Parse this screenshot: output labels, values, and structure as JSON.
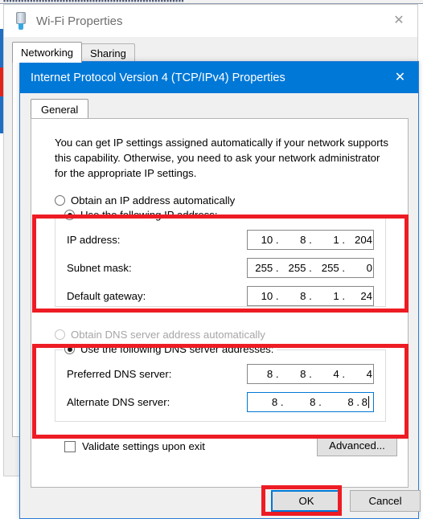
{
  "background_window": {
    "title": "Wi-Fi Properties",
    "icon": "network-adapter-icon",
    "close_label": "✕",
    "tabs": [
      {
        "label": "Networking",
        "active": true
      },
      {
        "label": "Sharing",
        "active": false
      }
    ]
  },
  "dialog": {
    "title": "Internet Protocol Version 4 (TCP/IPv4) Properties",
    "close_label": "✕",
    "tab": {
      "label": "General",
      "active": true
    },
    "intro_text": "You can get IP settings assigned automatically if your network supports this capability. Otherwise, you need to ask your network administrator for the appropriate IP settings.",
    "ip_section": {
      "auto_option": {
        "label": "Obtain an IP address automatically",
        "checked": false,
        "disabled": false
      },
      "manual_option": {
        "label": "Use the following IP address:",
        "checked": true,
        "disabled": false
      },
      "fields": [
        {
          "label": "IP address:",
          "name": "ip-address",
          "octets": [
            "10",
            "8",
            "1",
            "204"
          ],
          "focused": false
        },
        {
          "label": "Subnet mask:",
          "name": "subnet-mask",
          "octets": [
            "255",
            "255",
            "255",
            "0"
          ],
          "focused": false
        },
        {
          "label": "Default gateway:",
          "name": "default-gateway",
          "octets": [
            "10",
            "8",
            "1",
            "24"
          ],
          "focused": false
        }
      ]
    },
    "dns_section": {
      "auto_option": {
        "label": "Obtain DNS server address automatically",
        "checked": false,
        "disabled": true
      },
      "manual_option": {
        "label": "Use the following DNS server addresses:",
        "checked": true,
        "disabled": false
      },
      "fields": [
        {
          "label": "Preferred DNS server:",
          "name": "preferred-dns-server",
          "octets": [
            "8",
            "8",
            "4",
            "4"
          ],
          "focused": false
        },
        {
          "label": "Alternate DNS server:",
          "name": "alternate-dns-server",
          "octets": [
            "8",
            "8",
            "8",
            "8"
          ],
          "focused": true
        }
      ]
    },
    "validate_checkbox": {
      "label": "Validate settings upon exit",
      "checked": false
    },
    "advanced_button": "Advanced...",
    "ok_button": "OK",
    "cancel_button": "Cancel"
  },
  "annotations": {
    "highlight_color": "#ed1c24",
    "boxes": [
      "ip-address-section-highlight",
      "dns-section-highlight",
      "ok-button-highlight"
    ]
  },
  "colors": {
    "titlebar_blue": "#0078d7",
    "highlight_red": "#ed1c24",
    "dialog_bg": "#f0f0f0",
    "panel_white": "#ffffff"
  },
  "separators": {
    "dot": "."
  }
}
